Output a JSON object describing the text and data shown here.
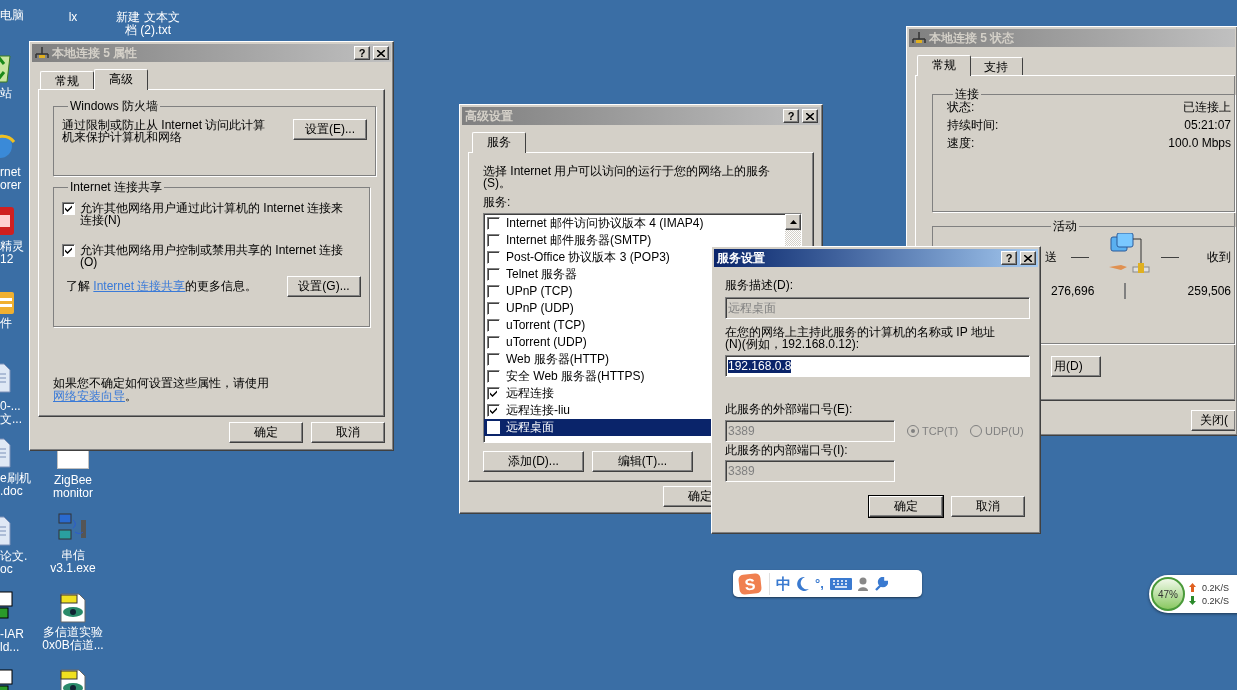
{
  "desktop_icons": [
    {
      "label": "电脑"
    },
    {
      "kind": "recycle",
      "label": "站"
    },
    {
      "kind": "globe",
      "label": "rnet\norer"
    },
    {
      "kind": "red-app",
      "label": "精灵\n12"
    },
    {
      "kind": "folder",
      "label": "件"
    },
    {
      "kind": "doc",
      "label": "0-...\n文..."
    },
    {
      "kind": "doc",
      "label": "e刷机\n.doc"
    },
    {
      "kind": "doc",
      "label": "论文.\noc"
    },
    {
      "kind": "iar",
      "label": "-IAR\nld..."
    },
    {
      "kind": "iar"
    },
    {
      "label": "lx"
    },
    {
      "label": "新建 文本文档 (2).txt"
    },
    {
      "kind": "blank",
      "label": "ZigBee\nmonitor"
    },
    {
      "kind": "network",
      "label": "串信\nv3.1.exe"
    },
    {
      "kind": "psd",
      "label": "多信道实验\n0x0B信道..."
    },
    {
      "kind": "psd"
    }
  ],
  "properties_window": {
    "title": "本地连接 5 属性",
    "active": false,
    "help_button": "?",
    "tabs": [
      {
        "label": "常规",
        "selected": false
      },
      {
        "label": "高级",
        "selected": true
      }
    ],
    "firewall": {
      "legend": "Windows 防火墙",
      "text": "通过限制或防止从 Internet 访问此计算机来保护计算机和网络",
      "button": "设置(E)..."
    },
    "sharing": {
      "legend": "Internet 连接共享",
      "options": [
        {
          "label": "允许其他网络用户通过此计算机的 Internet 连接来连接(N)",
          "checked": true
        },
        {
          "label": "允许其他网络用户控制或禁用共享的 Internet 连接(O)",
          "checked": true
        }
      ],
      "info_prefix": "了解 ",
      "info_link": "Internet 连接共享",
      "info_suffix": "的更多信息。",
      "button": "设置(G)..."
    },
    "help_text": "如果您不确定如何设置这些属性，请使用",
    "help_link": "网络安装向导",
    "help_suffix": "。",
    "buttons": [
      "确定",
      "取消"
    ]
  },
  "advanced_window": {
    "title": "高级设置",
    "active": false,
    "help_button": "?",
    "tabs": [
      {
        "label": "服务",
        "selected": true
      }
    ],
    "description": "选择 Internet 用户可以访问的运行于您的网络上的服务(S)。",
    "list_label": "服务:",
    "services": [
      {
        "label": "Internet 邮件访问协议版本 4 (IMAP4)",
        "checked": false,
        "selected": false
      },
      {
        "label": "Internet 邮件服务器(SMTP)",
        "checked": false,
        "selected": false
      },
      {
        "label": "Post-Office 协议版本 3 (POP3)",
        "checked": false,
        "selected": false
      },
      {
        "label": "Telnet 服务器",
        "checked": false,
        "selected": false
      },
      {
        "label": "UPnP (TCP)",
        "checked": false,
        "selected": false
      },
      {
        "label": "UPnP (UDP)",
        "checked": false,
        "selected": false
      },
      {
        "label": "uTorrent (TCP)",
        "checked": false,
        "selected": false
      },
      {
        "label": "uTorrent (UDP)",
        "checked": false,
        "selected": false
      },
      {
        "label": "Web 服务器(HTTP)",
        "checked": false,
        "selected": false
      },
      {
        "label": "安全 Web 服务器(HTTPS)",
        "checked": false,
        "selected": false
      },
      {
        "label": "远程连接",
        "checked": true,
        "selected": false
      },
      {
        "label": "远程连接-liu",
        "checked": true,
        "selected": false
      },
      {
        "label": "远程桌面",
        "checked": false,
        "selected": true
      }
    ],
    "buttons": [
      "添加(D)...",
      "编辑(T)..."
    ],
    "ok_button": "确定"
  },
  "service_dialog": {
    "title": "服务设置",
    "active": true,
    "help_button": "?",
    "description_label": "服务描述(D):",
    "description": {
      "value": "远程桌面",
      "disabled": true
    },
    "host_label": "在您的网络上主持此服务的计算机的名称或 IP 地址(N)(例如，192.168.0.12):",
    "host": {
      "value": "192.168.0.8",
      "disabled": false
    },
    "external_port_label": "此服务的外部端口号(E):",
    "external_port": {
      "value": "3389",
      "disabled": true
    },
    "protocols": [
      {
        "label": "TCP(T)",
        "selected": true,
        "disabled": true
      },
      {
        "label": "UDP(U)",
        "selected": false,
        "disabled": true
      }
    ],
    "internal_port_label": "此服务的内部端口号(I):",
    "internal_port": {
      "value": "3389",
      "disabled": true
    },
    "buttons": [
      "确定",
      "取消"
    ]
  },
  "status_window": {
    "title": "本地连接 5 状态",
    "active": false,
    "tabs": [
      {
        "label": "常规",
        "selected": true
      },
      {
        "label": "支持",
        "selected": false
      }
    ],
    "connection": {
      "legend": "连接",
      "rows": [
        {
          "label": "状态:",
          "value": "已连接上"
        },
        {
          "label": "持续时间:",
          "value": "05:21:07"
        },
        {
          "label": "速度:",
          "value": "100.0 Mbps"
        }
      ]
    },
    "activity": {
      "legend": "活动",
      "sent_label": "送",
      "received_label": "收到",
      "sent": "276,696",
      "received": "259,506"
    },
    "buttons": [
      "用(D)",
      "关闭("
    ]
  },
  "ime_toolbar": {
    "logo": "S",
    "mode": "中",
    "punctuation": "°,"
  },
  "net_meter": {
    "percent": "47%",
    "upload": "0.2K/S",
    "download": "0.2K/S"
  }
}
